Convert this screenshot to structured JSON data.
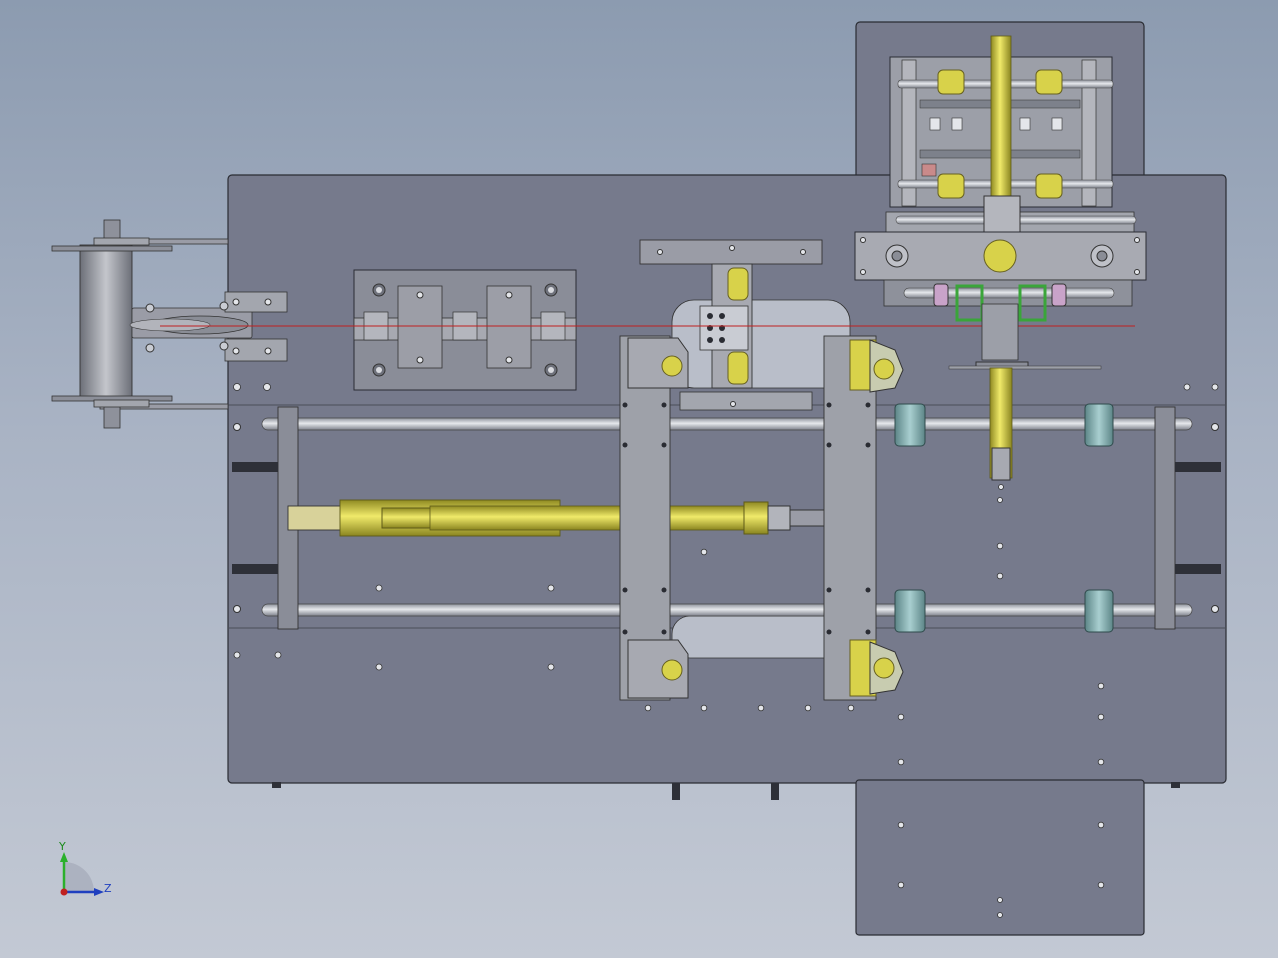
{
  "viewport": {
    "background_top": "#8c9bb0",
    "background_bottom": "#c3c9d4"
  },
  "colors": {
    "plate": "#767a8c",
    "plate_edge": "#2a2c33",
    "part_gray": "#9a9ca6",
    "part_light": "#b8bac2",
    "rod": "#c9ccd3",
    "yellow": "#d8d24a",
    "yellow_dark": "#8a8520",
    "teal": "#7fa6a8",
    "pink": "#c9a3c9",
    "green": "#3aa53a",
    "red_line": "#c02020"
  },
  "triad": {
    "y_label": "Y",
    "z_label": "Z",
    "y_icon": "axis-y-arrow-icon",
    "z_icon": "axis-z-arrow-icon"
  }
}
